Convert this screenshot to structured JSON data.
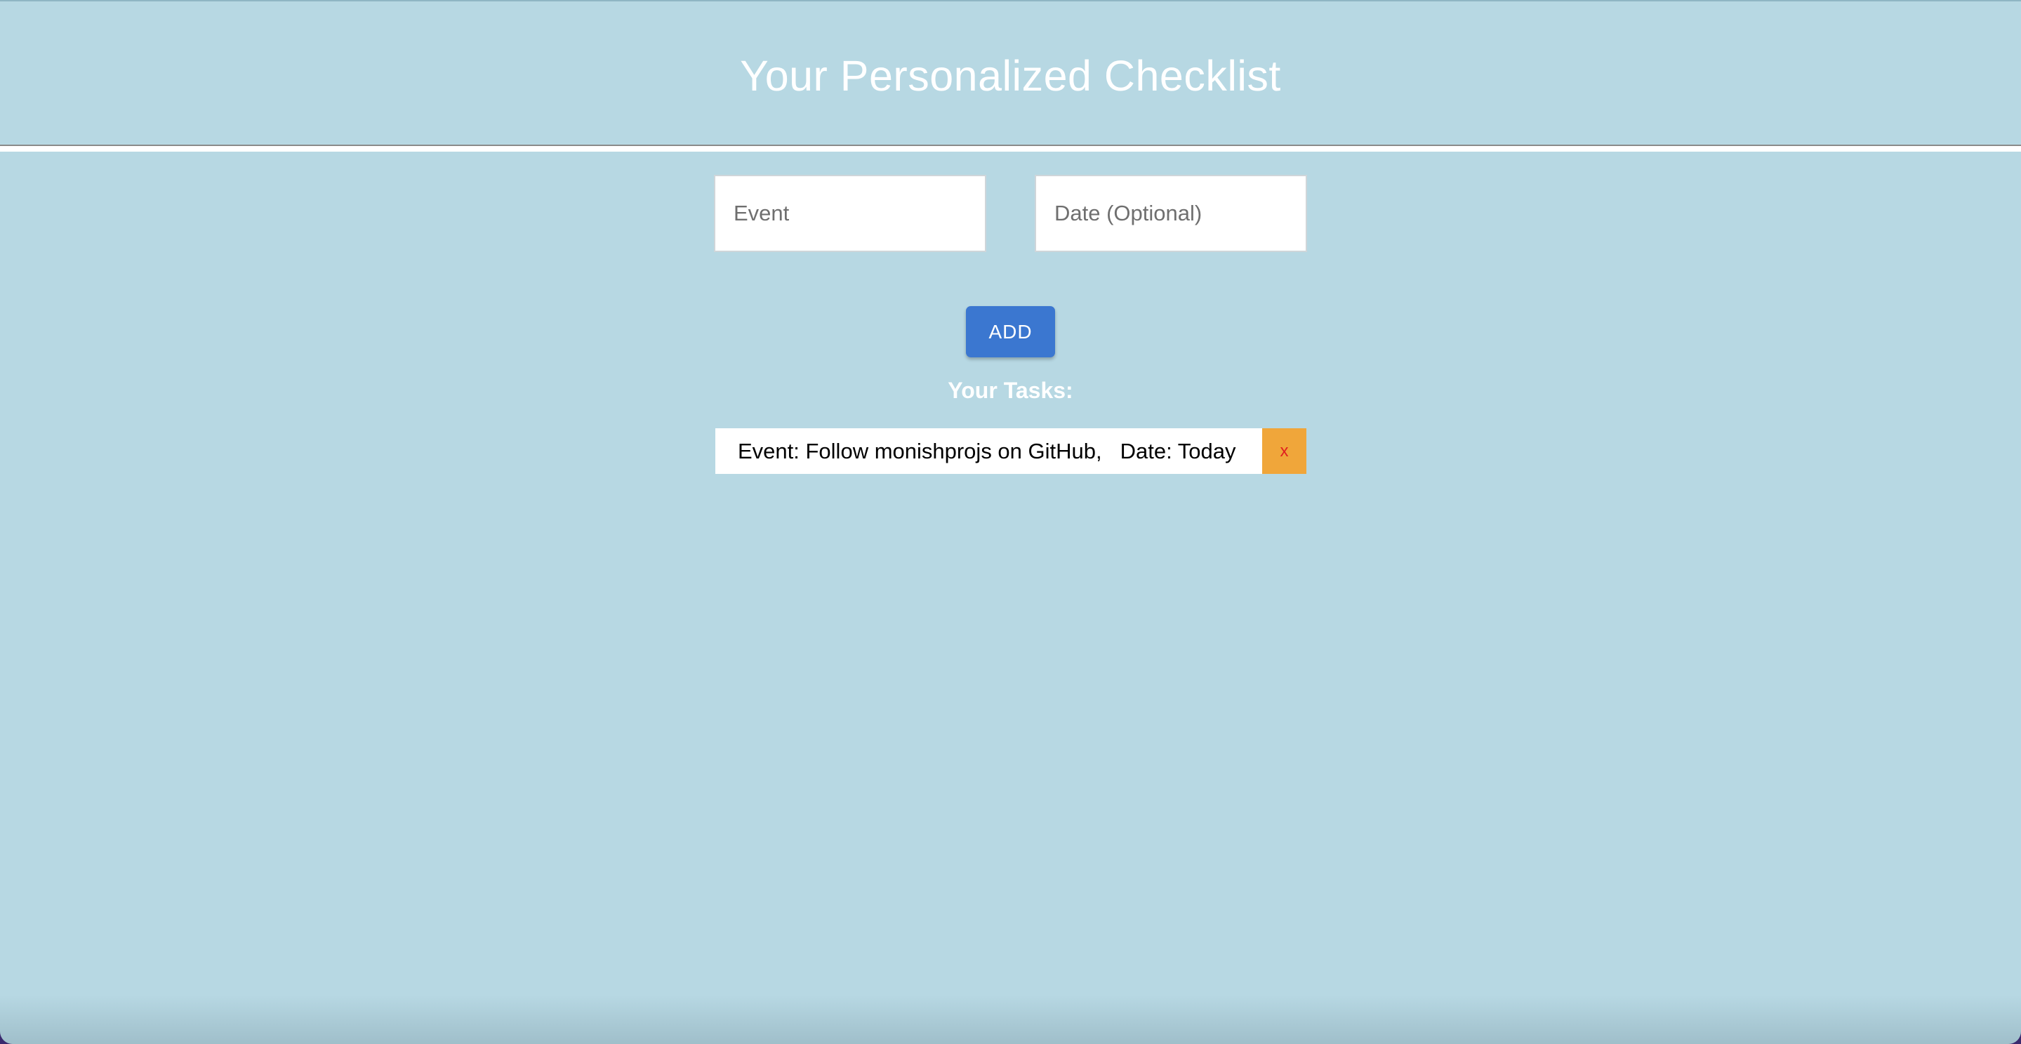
{
  "header": {
    "title": "Your Personalized Checklist"
  },
  "form": {
    "event_placeholder": "Event",
    "date_placeholder": "Date (Optional)",
    "event_value": "",
    "date_value": "",
    "add_label": "ADD"
  },
  "tasks": {
    "heading": "Your Tasks:",
    "items": [
      {
        "event_text": "Event: Follow monishprojs on GitHub,",
        "date_text": "Date: Today",
        "delete_label": "x"
      }
    ]
  },
  "colors": {
    "background": "#b7d8e3",
    "add_button": "#3b77d0",
    "delete_button": "#f0a63a",
    "delete_glyph": "#e02020"
  }
}
